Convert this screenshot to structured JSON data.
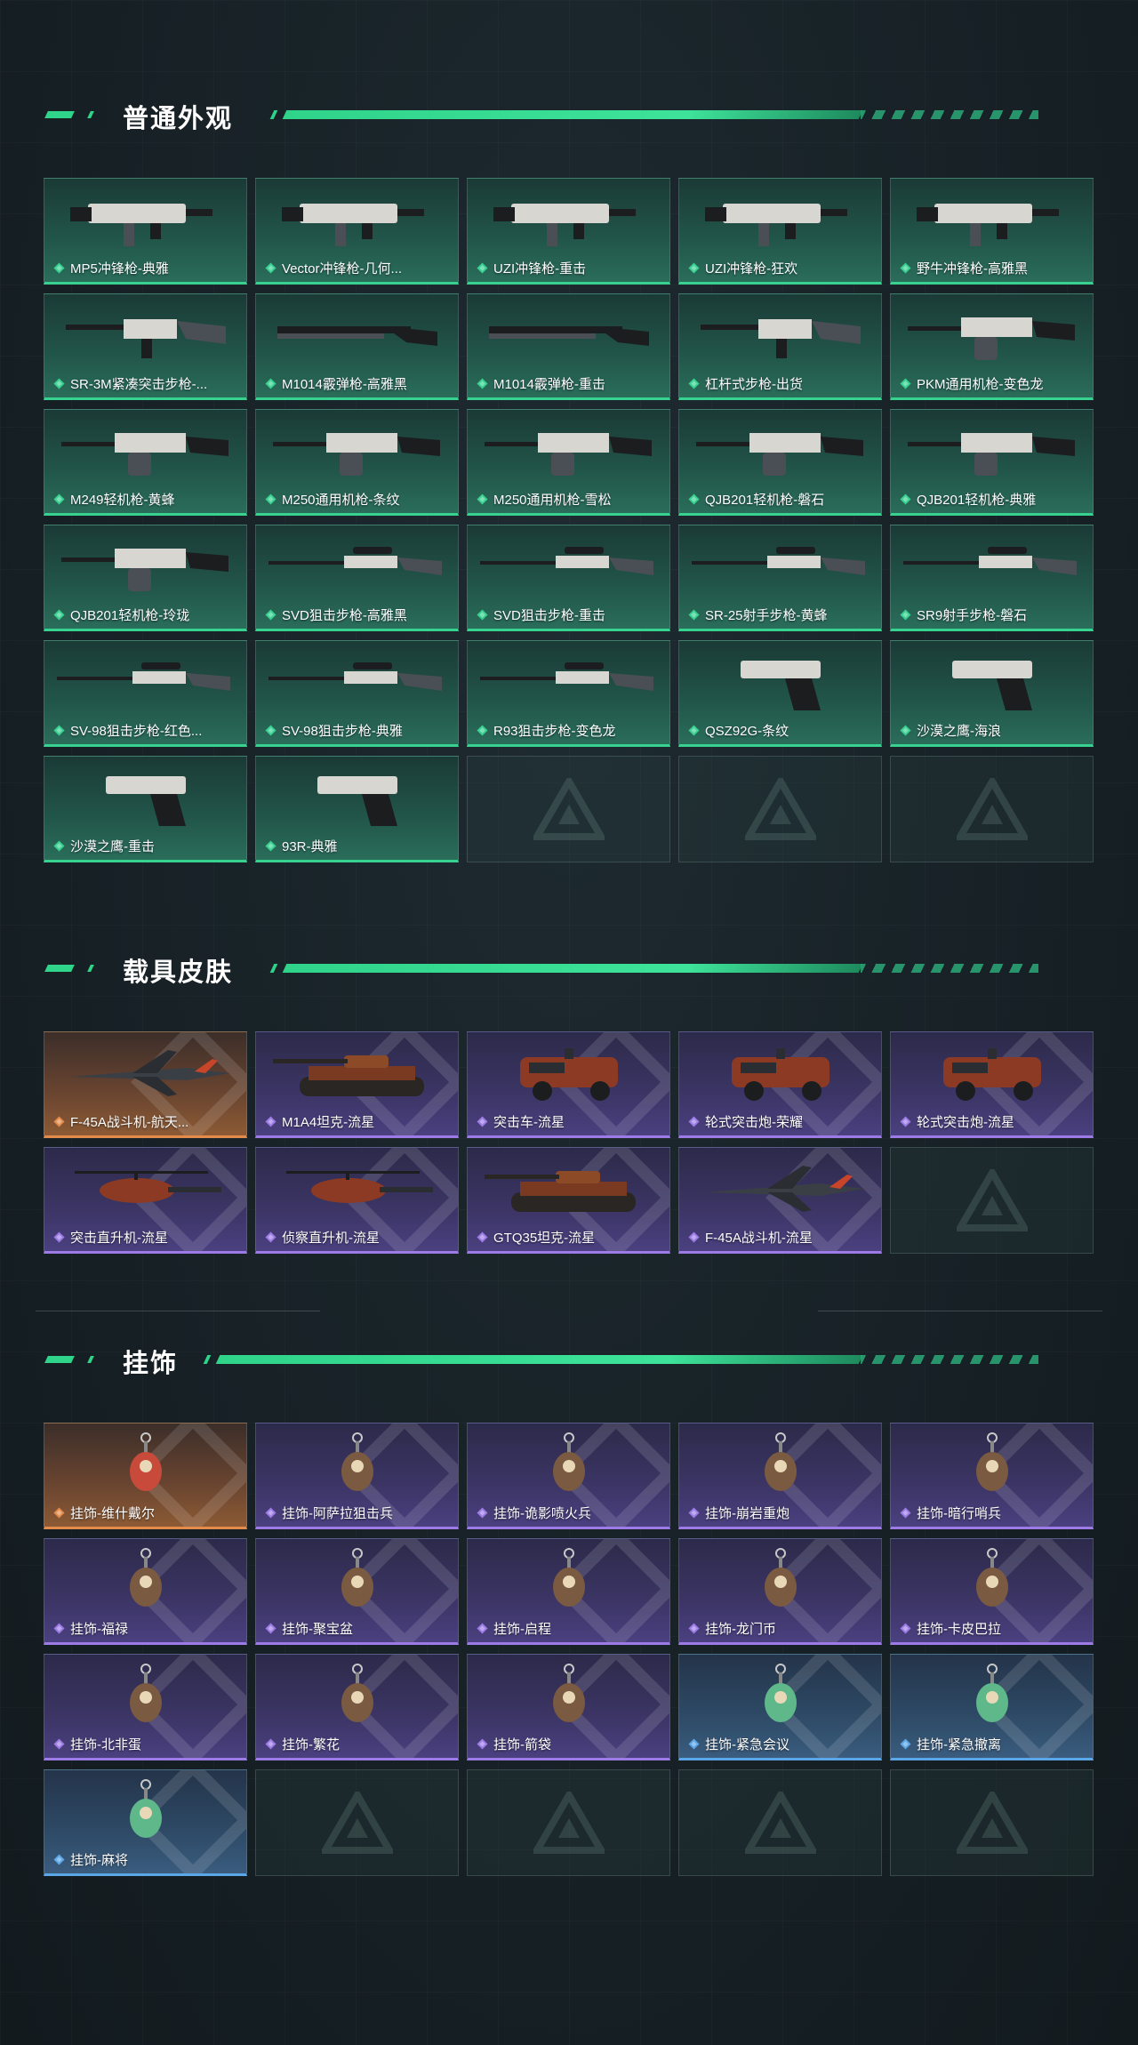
{
  "sections": [
    {
      "title": "普通外观",
      "items": [
        {
          "label": "MP5冲锋枪-典雅",
          "rarity": "green",
          "icon": "smg-icon"
        },
        {
          "label": "Vector冲锋枪-几何...",
          "rarity": "green",
          "icon": "smg-icon"
        },
        {
          "label": "UZI冲锋枪-重击",
          "rarity": "green",
          "icon": "smg-icon"
        },
        {
          "label": "UZI冲锋枪-狂欢",
          "rarity": "green",
          "icon": "smg-icon"
        },
        {
          "label": "野牛冲锋枪-高雅黑",
          "rarity": "green",
          "icon": "smg-icon"
        },
        {
          "label": "SR-3M紧凑突击步枪-...",
          "rarity": "green",
          "icon": "rifle-icon"
        },
        {
          "label": "M1014霰弹枪-高雅黑",
          "rarity": "green",
          "icon": "shotgun-icon"
        },
        {
          "label": "M1014霰弹枪-重击",
          "rarity": "green",
          "icon": "shotgun-icon"
        },
        {
          "label": "杠杆式步枪-出货",
          "rarity": "green",
          "icon": "rifle-icon"
        },
        {
          "label": "PKM通用机枪-变色龙",
          "rarity": "green",
          "icon": "machine-gun-icon"
        },
        {
          "label": "M249轻机枪-黄蜂",
          "rarity": "green",
          "icon": "machine-gun-icon"
        },
        {
          "label": "M250通用机枪-条纹",
          "rarity": "green",
          "icon": "machine-gun-icon"
        },
        {
          "label": "M250通用机枪-雪松",
          "rarity": "green",
          "icon": "machine-gun-icon"
        },
        {
          "label": "QJB201轻机枪-磐石",
          "rarity": "green",
          "icon": "machine-gun-icon"
        },
        {
          "label": "QJB201轻机枪-典雅",
          "rarity": "green",
          "icon": "machine-gun-icon"
        },
        {
          "label": "QJB201轻机枪-玲珑",
          "rarity": "green",
          "icon": "machine-gun-icon"
        },
        {
          "label": "SVD狙击步枪-高雅黑",
          "rarity": "green",
          "icon": "sniper-icon"
        },
        {
          "label": "SVD狙击步枪-重击",
          "rarity": "green",
          "icon": "sniper-icon"
        },
        {
          "label": "SR-25射手步枪-黄蜂",
          "rarity": "green",
          "icon": "sniper-icon"
        },
        {
          "label": "SR9射手步枪-磐石",
          "rarity": "green",
          "icon": "sniper-icon"
        },
        {
          "label": "SV-98狙击步枪-红色...",
          "rarity": "green",
          "icon": "sniper-icon"
        },
        {
          "label": "SV-98狙击步枪-典雅",
          "rarity": "green",
          "icon": "sniper-icon"
        },
        {
          "label": "R93狙击步枪-变色龙",
          "rarity": "green",
          "icon": "sniper-icon"
        },
        {
          "label": "QSZ92G-条纹",
          "rarity": "green",
          "icon": "pistol-icon"
        },
        {
          "label": "沙漠之鹰-海浪",
          "rarity": "green",
          "icon": "pistol-icon"
        },
        {
          "label": "沙漠之鹰-重击",
          "rarity": "green",
          "icon": "pistol-icon"
        },
        {
          "label": "93R-典雅",
          "rarity": "green",
          "icon": "pistol-icon"
        }
      ],
      "empty_slots": 3
    },
    {
      "title": "载具皮肤",
      "items": [
        {
          "label": "F-45A战斗机-航天...",
          "rarity": "orange",
          "icon": "jet-icon"
        },
        {
          "label": "M1A4坦克-流星",
          "rarity": "purple",
          "icon": "tank-icon"
        },
        {
          "label": "突击车-流星",
          "rarity": "purple",
          "icon": "truck-icon"
        },
        {
          "label": "轮式突击炮-荣耀",
          "rarity": "purple",
          "icon": "armored-car-icon"
        },
        {
          "label": "轮式突击炮-流星",
          "rarity": "purple",
          "icon": "armored-car-icon"
        },
        {
          "label": "突击直升机-流星",
          "rarity": "purple",
          "icon": "helicopter-icon"
        },
        {
          "label": "侦察直升机-流星",
          "rarity": "purple",
          "icon": "helicopter-icon"
        },
        {
          "label": "GTQ35坦克-流星",
          "rarity": "purple",
          "icon": "tank-icon"
        },
        {
          "label": "F-45A战斗机-流星",
          "rarity": "purple",
          "icon": "jet-icon"
        }
      ],
      "empty_slots": 1
    },
    {
      "title": "挂饰",
      "items": [
        {
          "label": "挂饰-维什戴尔",
          "rarity": "orange",
          "icon": "charm-icon"
        },
        {
          "label": "挂饰-阿萨拉狙击兵",
          "rarity": "purple",
          "icon": "charm-icon"
        },
        {
          "label": "挂饰-诡影喷火兵",
          "rarity": "purple",
          "icon": "charm-icon"
        },
        {
          "label": "挂饰-崩岩重炮",
          "rarity": "purple",
          "icon": "charm-icon"
        },
        {
          "label": "挂饰-暗行哨兵",
          "rarity": "purple",
          "icon": "charm-icon"
        },
        {
          "label": "挂饰-福禄",
          "rarity": "purple",
          "icon": "charm-icon"
        },
        {
          "label": "挂饰-聚宝盆",
          "rarity": "purple",
          "icon": "charm-icon"
        },
        {
          "label": "挂饰-启程",
          "rarity": "purple",
          "icon": "charm-icon"
        },
        {
          "label": "挂饰-龙门币",
          "rarity": "purple",
          "icon": "charm-icon"
        },
        {
          "label": "挂饰-卡皮巴拉",
          "rarity": "purple",
          "icon": "charm-icon"
        },
        {
          "label": "挂饰-北非蛋",
          "rarity": "purple",
          "icon": "charm-icon"
        },
        {
          "label": "挂饰-繁花",
          "rarity": "purple",
          "icon": "charm-icon"
        },
        {
          "label": "挂饰-箭袋",
          "rarity": "purple",
          "icon": "charm-icon"
        },
        {
          "label": "挂饰-紧急会议",
          "rarity": "blue",
          "icon": "charm-icon"
        },
        {
          "label": "挂饰-紧急撤离",
          "rarity": "blue",
          "icon": "charm-icon"
        },
        {
          "label": "挂饰-麻将",
          "rarity": "blue",
          "icon": "charm-icon"
        }
      ],
      "empty_slots": 4
    }
  ],
  "colors": {
    "accent": "#2fd38a",
    "green": "#37d190",
    "purple": "#9d7be6",
    "orange": "#e38b4a",
    "blue": "#5aa6e6"
  }
}
